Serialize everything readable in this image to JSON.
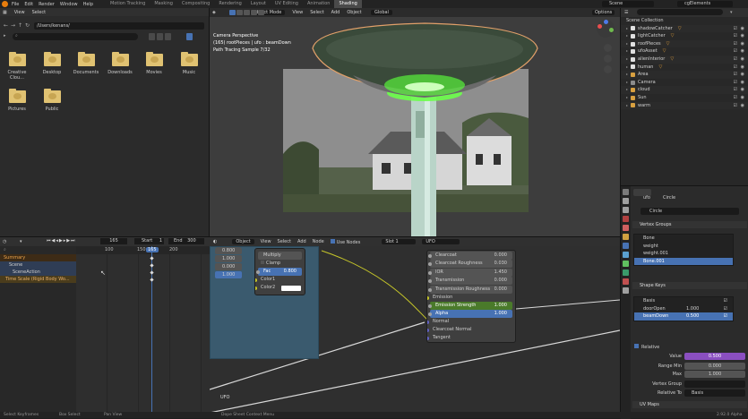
{
  "topbar": {
    "menu": [
      "File",
      "Edit",
      "Render",
      "Window",
      "Help"
    ],
    "workspaces": [
      "Motion Tracking",
      "Masking",
      "Compositing",
      "Rendering",
      "Layout",
      "UV Editing",
      "Animation",
      "Shading"
    ],
    "active_workspace": "Shading",
    "scene": "Scene",
    "view_layer": "cgElements"
  },
  "filebrowser": {
    "menu": [
      "View",
      "Select"
    ],
    "path": "/Users/kenans/",
    "folders": [
      "Creative Clou...",
      "Desktop",
      "Documents",
      "Downloads",
      "Movies",
      "Music",
      "Pictures",
      "Public"
    ]
  },
  "viewport": {
    "mode": "Object Mode",
    "menu": [
      "View",
      "Select",
      "Add",
      "Object"
    ],
    "transform": "Global",
    "options": "Options",
    "info": [
      "Camera Perspective",
      "(165) rootPieces | ufo : beamDown",
      "Path Tracing Sample 7/32"
    ]
  },
  "outliner": {
    "title": "Scene Collection",
    "items": [
      {
        "name": "shadowCatcher",
        "color": "#e0e0e0",
        "mod": "▽"
      },
      {
        "name": "lightCatcher",
        "color": "#e0e0e0",
        "mod": "▽"
      },
      {
        "name": "roofPieces",
        "color": "#e0e0e0",
        "mod": "▽"
      },
      {
        "name": "ufoAsset",
        "color": "#e0e0e0",
        "mod": "▽"
      },
      {
        "name": "alienInterior",
        "color": "#e0e0e0",
        "mod": "▽"
      },
      {
        "name": "human",
        "color": "#e0e0e0",
        "mod": "▽"
      },
      {
        "name": "Area",
        "color": "#d8a040",
        "mod": ""
      },
      {
        "name": "Camera",
        "color": "#8c8c8c",
        "mod": ""
      },
      {
        "name": "cloud",
        "color": "#d8a040",
        "mod": ""
      },
      {
        "name": "Sun",
        "color": "#d8a040",
        "mod": ""
      },
      {
        "name": "warm",
        "color": "#d8a040",
        "mod": ""
      }
    ]
  },
  "properties": {
    "object": "ufo",
    "data": "Circle",
    "mesh_field": "Circle",
    "vertex_groups_title": "Vertex Groups",
    "vertex_groups": [
      "Bone",
      "weight",
      "weight.001",
      "Bone.001"
    ],
    "shape_keys_title": "Shape Keys",
    "shape_keys": [
      {
        "name": "Basis",
        "value": ""
      },
      {
        "name": "doorOpen",
        "value": "1.000"
      },
      {
        "name": "beamDown",
        "value": "0.500"
      }
    ],
    "relative_label": "Relative",
    "value_label": "Value",
    "value": "0.500",
    "range_min_label": "Range Min",
    "range_min": "0.000",
    "max_label": "Max",
    "max": "1.000",
    "vertex_group_label": "Vertex Group",
    "relative_to_label": "Relative To",
    "relative_to": "Basis",
    "uv_maps_title": "UV Maps"
  },
  "dopesheet": {
    "current_frame": "165",
    "start_label": "Start",
    "start": "1",
    "end_label": "End",
    "end": "300",
    "ruler": [
      "100",
      "150",
      "165",
      "200"
    ],
    "channels": [
      "Summary",
      "Scene",
      "SceneAction",
      "Time Scale (Rigid Body Wo..."
    ]
  },
  "nodeeditor": {
    "mode": "Object",
    "menu": [
      "View",
      "Select",
      "Add",
      "Node"
    ],
    "use_nodes": "Use Nodes",
    "slot": "Slot 1",
    "material": "UFO",
    "frame_label": "UFO",
    "mix_node": {
      "values_left": [
        "0.800",
        "1.000",
        "0.000",
        "1.000"
      ],
      "blend": "Multiply",
      "clamp": "Clamp",
      "fac_label": "Fac",
      "fac": "0.800",
      "color1": "Color1",
      "color2": "Color2"
    },
    "bsdf_rows": [
      {
        "label": "Clearcoat",
        "value": "0.000",
        "type": "field"
      },
      {
        "label": "Clearcoat Roughness",
        "value": "0.030",
        "type": "field"
      },
      {
        "label": "IOR",
        "value": "1.450",
        "type": "field"
      },
      {
        "label": "Transmission",
        "value": "0.000",
        "type": "field"
      },
      {
        "label": "Transmission Roughness",
        "value": "0.000",
        "type": "field"
      },
      {
        "label": "Emission",
        "value": "",
        "type": "plain"
      },
      {
        "label": "Emission Strength",
        "value": "1.000",
        "type": "green"
      },
      {
        "label": "Alpha",
        "value": "1.000",
        "type": "blue"
      },
      {
        "label": "Normal",
        "value": "",
        "type": "plain"
      },
      {
        "label": "Clearcoat Normal",
        "value": "",
        "type": "plain"
      },
      {
        "label": "Tangent",
        "value": "",
        "type": "plain"
      }
    ]
  },
  "statusbar": {
    "items": [
      "Select Keyframes",
      "Box Select",
      "Pan View",
      "Dope Sheet Context Menu"
    ],
    "version": "2.92.0 Alpha"
  },
  "colors": {
    "accent": "#4772b3",
    "orange": "#e87d0d",
    "green_emission": "#4a7a2a",
    "value_purple": "#8a4fc0"
  }
}
